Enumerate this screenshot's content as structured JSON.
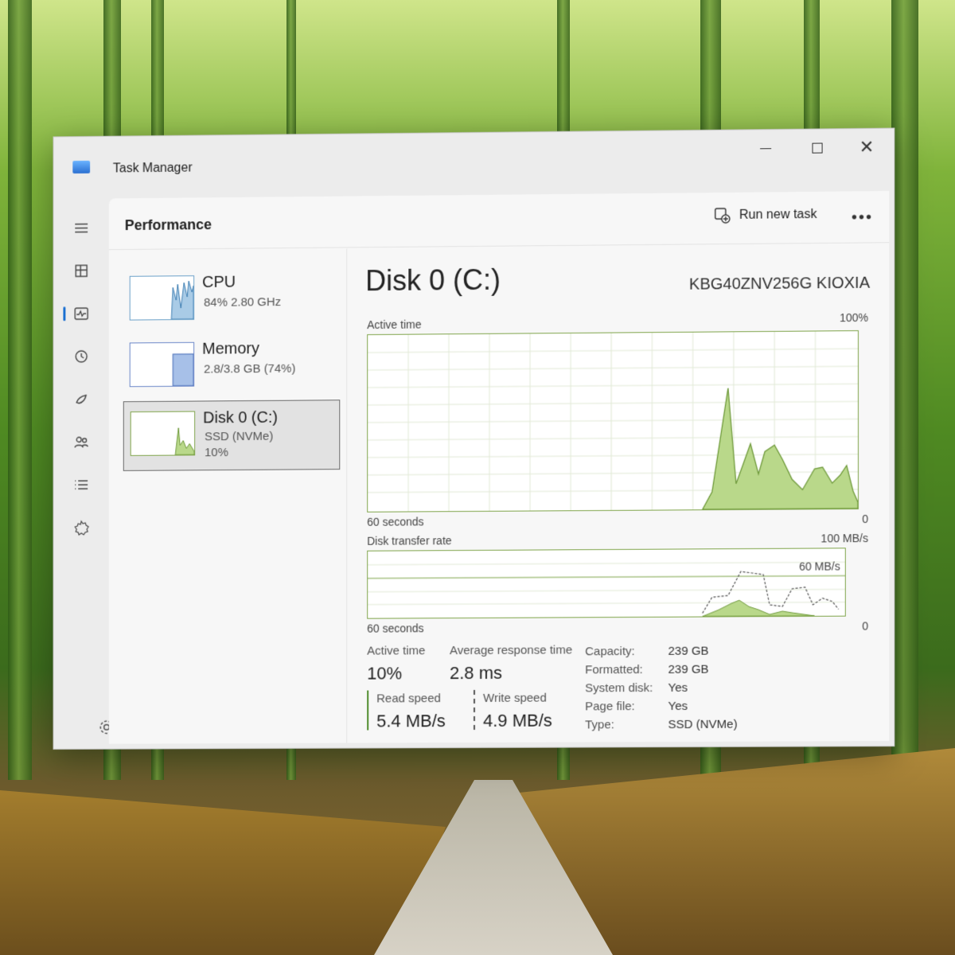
{
  "window": {
    "title": "Task Manager"
  },
  "header": {
    "title": "Performance",
    "run_task": "Run new task",
    "more": "•••"
  },
  "nav": {
    "items": [
      "menu",
      "processes",
      "performance",
      "app-history",
      "startup",
      "users",
      "details",
      "services"
    ],
    "active": "performance"
  },
  "sidelist": [
    {
      "name": "CPU",
      "line1": "84%  2.80 GHz"
    },
    {
      "name": "Memory",
      "line1": "2.8/3.8 GB (74%)"
    },
    {
      "name": "Disk 0 (C:)",
      "line1": "SSD (NVMe)",
      "line2": "10%"
    }
  ],
  "detail": {
    "title": "Disk 0 (C:)",
    "model": "KBG40ZNV256G KIOXIA",
    "active_time_label": "Active time",
    "active_time_max": "100%",
    "seconds_label": "60 seconds",
    "zero": "0",
    "transfer_label": "Disk transfer rate",
    "transfer_max": "100 MB/s",
    "transfer_mid": "60 MB/s",
    "stats": {
      "active_time_label": "Active time",
      "active_time_value": "10%",
      "avg_response_label": "Average response time",
      "avg_response_value": "2.8 ms",
      "read_label": "Read speed",
      "read_value": "5.4 MB/s",
      "write_label": "Write speed",
      "write_value": "4.9 MB/s"
    },
    "props": {
      "capacity_label": "Capacity:",
      "capacity_value": "239 GB",
      "formatted_label": "Formatted:",
      "formatted_value": "239 GB",
      "system_label": "System disk:",
      "system_value": "Yes",
      "pagefile_label": "Page file:",
      "pagefile_value": "Yes",
      "type_label": "Type:",
      "type_value": "SSD (NVMe)"
    }
  },
  "colors": {
    "disk_fill": "#b9d88a",
    "disk_line": "#6f9a3b",
    "accent": "#1a6fd1"
  }
}
